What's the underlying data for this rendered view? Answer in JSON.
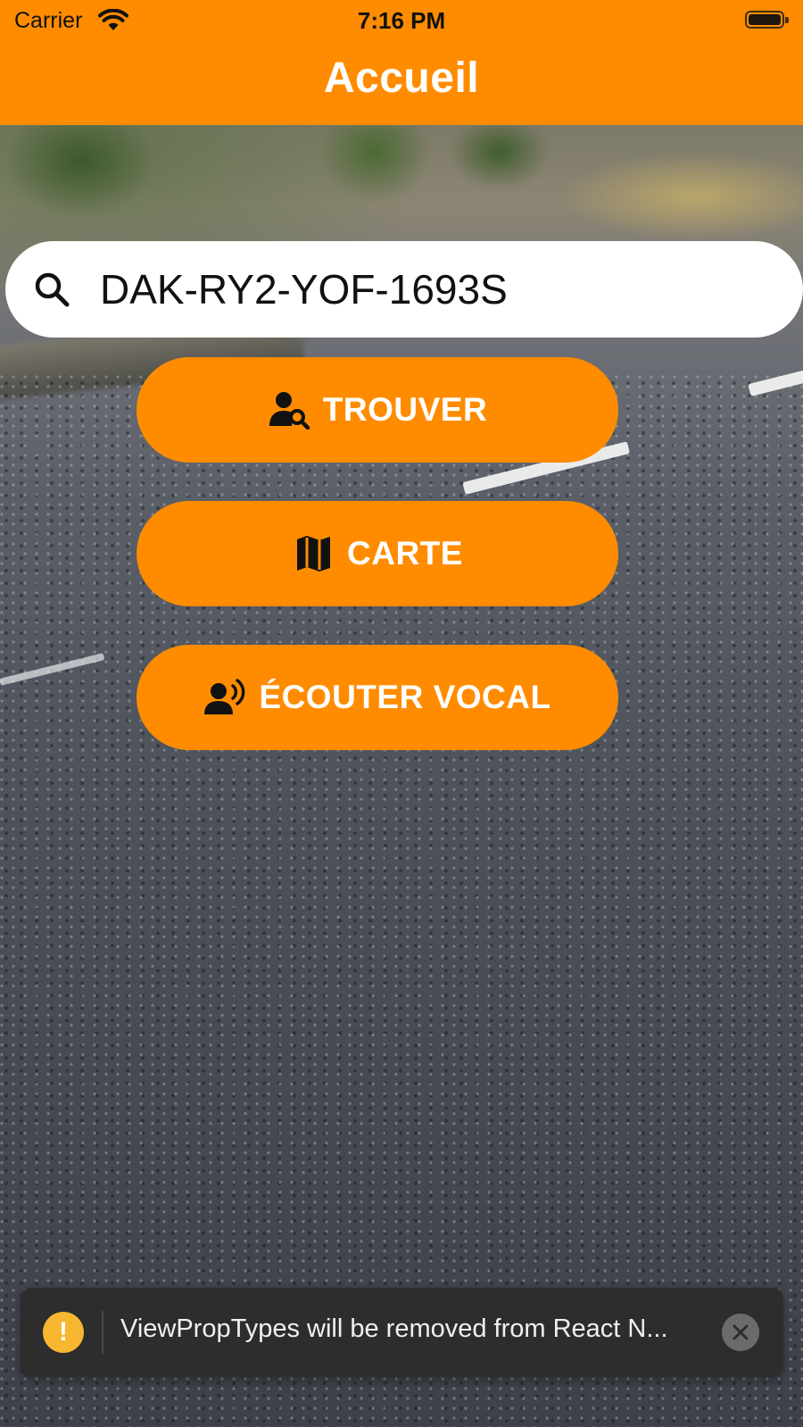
{
  "status_bar": {
    "carrier": "Carrier",
    "time": "7:16 PM"
  },
  "header": {
    "title": "Accueil",
    "color": "#ff8c00"
  },
  "search": {
    "value": "DAK-RY2-YOF-1693S",
    "icon": "search-icon"
  },
  "actions": [
    {
      "label": "TROUVER",
      "icon": "person-search-icon"
    },
    {
      "label": "CARTE",
      "icon": "map-icon"
    },
    {
      "label": "ÉCOUTER VOCAL",
      "icon": "voice-speaker-icon"
    }
  ],
  "toast": {
    "message": "ViewPropTypes will be removed from React N...",
    "icon": "warning-icon",
    "warning_color": "#f7b731"
  }
}
